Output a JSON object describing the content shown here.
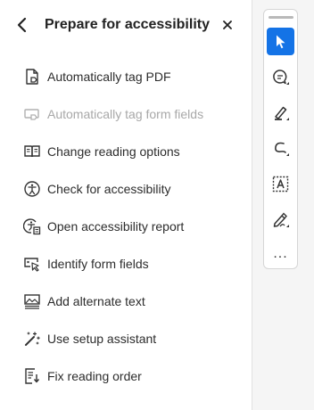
{
  "header": {
    "title": "Prepare for accessibility",
    "back_icon": "chevron-left-icon",
    "close_icon": "close-icon"
  },
  "menu": {
    "items": [
      {
        "label": "Automatically tag PDF",
        "icon": "tag-pdf-icon",
        "enabled": true
      },
      {
        "label": "Automatically tag form fields",
        "icon": "tag-form-fields-icon",
        "enabled": false
      },
      {
        "label": "Change reading options",
        "icon": "book-icon",
        "enabled": true
      },
      {
        "label": "Check for accessibility",
        "icon": "accessibility-check-icon",
        "enabled": true
      },
      {
        "label": "Open accessibility report",
        "icon": "accessibility-report-icon",
        "enabled": true
      },
      {
        "label": "Identify form fields",
        "icon": "identify-form-fields-icon",
        "enabled": true
      },
      {
        "label": "Add alternate text",
        "icon": "alt-text-icon",
        "enabled": true
      },
      {
        "label": "Use setup assistant",
        "icon": "magic-wand-icon",
        "enabled": true
      },
      {
        "label": "Fix reading order",
        "icon": "reading-order-icon",
        "enabled": true
      }
    ]
  },
  "toolbar": {
    "tools": [
      {
        "icon": "select-cursor-icon",
        "active": true
      },
      {
        "icon": "comment-icon",
        "active": false
      },
      {
        "icon": "highlight-pen-icon",
        "active": false
      },
      {
        "icon": "freehand-draw-icon",
        "active": false
      },
      {
        "icon": "text-box-icon",
        "active": false
      },
      {
        "icon": "signature-pen-icon",
        "active": false
      }
    ],
    "more_label": "...",
    "accent_color": "#1473e6"
  }
}
